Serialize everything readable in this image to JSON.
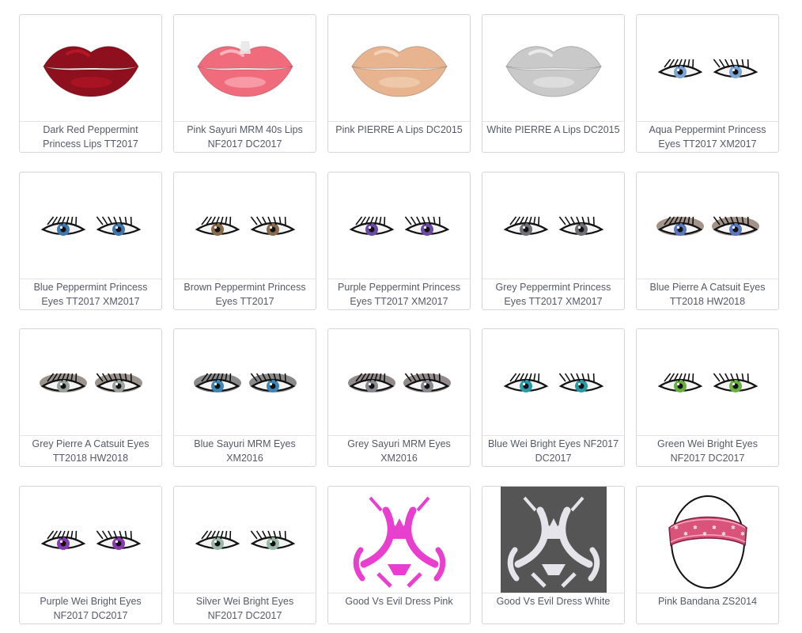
{
  "items": [
    {
      "title": "Dark Red Peppermint Princess Lips TT2017",
      "kind": "lips",
      "color": "#8e0f1d",
      "shine": "#c2182b"
    },
    {
      "title": "Pink Sayuri MRM 40s Lips NF2017 DC2017",
      "kind": "lips",
      "color": "#f06b7c",
      "shine": "#ffc7cf",
      "accent": "#e8e8e8"
    },
    {
      "title": "Pink PIERRE A Lips DC2015",
      "kind": "lips",
      "color": "#e7b48f",
      "shine": "#f6dcc4"
    },
    {
      "title": "White PIERRE A Lips DC2015",
      "kind": "lips",
      "color": "#c9c9c9",
      "shine": "#f2f2f2"
    },
    {
      "title": "Aqua Peppermint Princess Eyes TT2017 XM2017",
      "kind": "eyes",
      "iris": "#7aa6d6"
    },
    {
      "title": "Blue Peppermint Princess Eyes TT2017 XM2017",
      "kind": "eyes",
      "iris": "#3f78b0"
    },
    {
      "title": "Brown Peppermint Princess Eyes TT2017",
      "kind": "eyes",
      "iris": "#8a6a4a"
    },
    {
      "title": "Purple Peppermint Princess Eyes TT2017 XM2017",
      "kind": "eyes",
      "iris": "#6d4aa8"
    },
    {
      "title": "Grey Peppermint Princess Eyes TT2017 XM2017",
      "kind": "eyes",
      "iris": "#6f6f78"
    },
    {
      "title": "Blue Pierre A Catsuit Eyes TT2018 HW2018",
      "kind": "eyes",
      "iris": "#5b79c2",
      "shadow": "#5a3a28"
    },
    {
      "title": "Grey Pierre A Catsuit Eyes TT2018 HW2018",
      "kind": "eyes",
      "iris": "#9aa3a0",
      "shadow": "#4a3a30"
    },
    {
      "title": "Blue Sayuri MRM Eyes XM2016",
      "kind": "eyes",
      "iris": "#3d86b8",
      "shadow": "#2a2a2a"
    },
    {
      "title": "Grey Sayuri MRM Eyes XM2016",
      "kind": "eyes",
      "iris": "#8a8a92",
      "shadow": "#3a2a2a"
    },
    {
      "title": "Blue Wei Bright Eyes NF2017 DC2017",
      "kind": "eyes",
      "iris": "#2a9aa8"
    },
    {
      "title": "Green Wei Bright Eyes NF2017 DC2017",
      "kind": "eyes",
      "iris": "#6ab040"
    },
    {
      "title": "Purple Wei Bright Eyes NF2017 DC2017",
      "kind": "eyes",
      "iris": "#8a3ab0"
    },
    {
      "title": "Silver Wei Bright Eyes NF2017 DC2017",
      "kind": "eyes",
      "iris": "#9ab8a8"
    },
    {
      "title": "Good Vs Evil Dress Pink",
      "kind": "dress",
      "color": "#e83fcf",
      "bg": "#ffffff"
    },
    {
      "title": "Good Vs Evil Dress White",
      "kind": "dress",
      "color": "#e4e4ea",
      "bg": "#555555"
    },
    {
      "title": "Pink Bandana ZS2014",
      "kind": "bandana",
      "color": "#d9537a"
    }
  ]
}
